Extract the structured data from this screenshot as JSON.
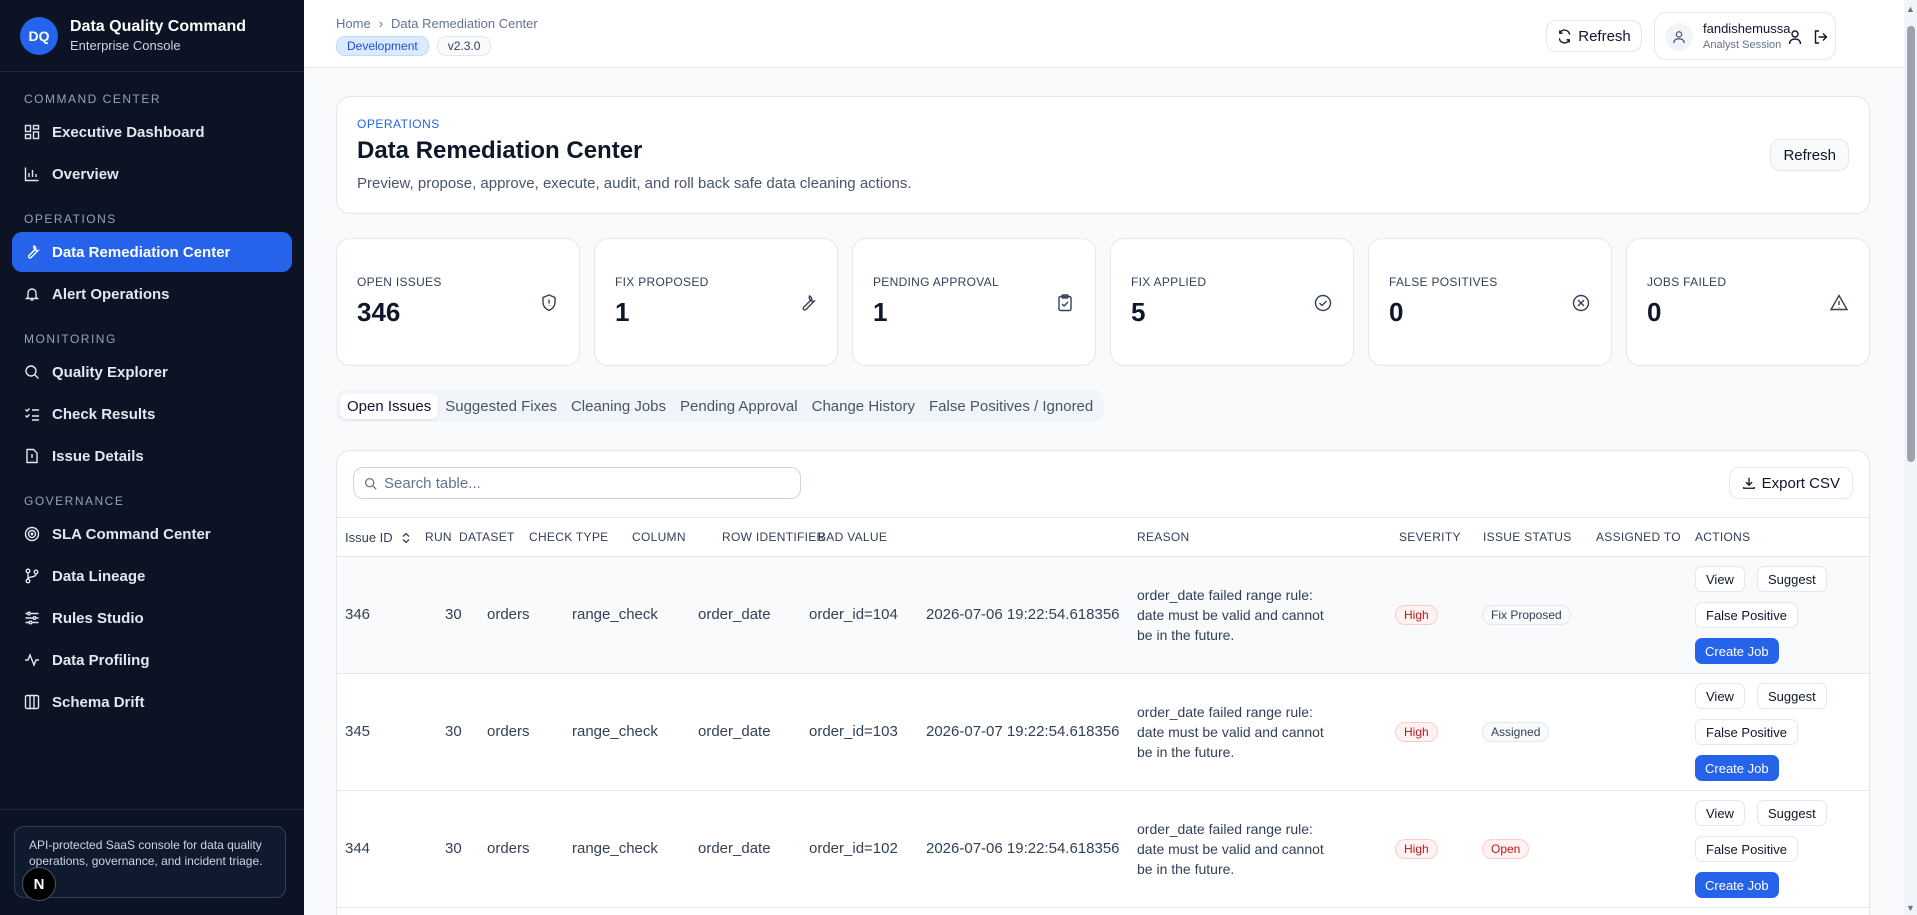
{
  "brand": {
    "logo": "DQ",
    "title": "Data Quality Command",
    "subtitle": "Enterprise Console"
  },
  "sidebar": {
    "sections": [
      {
        "label": "COMMAND CENTER"
      },
      {
        "label": "OPERATIONS"
      },
      {
        "label": "MONITORING"
      },
      {
        "label": "GOVERNANCE"
      }
    ],
    "items": [
      {
        "label": "Executive Dashboard",
        "icon": "dashboard-icon"
      },
      {
        "label": "Overview",
        "icon": "bar-chart-icon"
      },
      {
        "label": "Data Remediation Center",
        "icon": "wrench-icon",
        "active": true
      },
      {
        "label": "Alert Operations",
        "icon": "bell-icon"
      },
      {
        "label": "Quality Explorer",
        "icon": "search-zoom-icon"
      },
      {
        "label": "Check Results",
        "icon": "list-checks-icon"
      },
      {
        "label": "Issue Details",
        "icon": "file-alert-icon"
      },
      {
        "label": "SLA Command Center",
        "icon": "target-icon"
      },
      {
        "label": "Data Lineage",
        "icon": "git-branch-icon"
      },
      {
        "label": "Rules Studio",
        "icon": "sliders-icon"
      },
      {
        "label": "Data Profiling",
        "icon": "activity-icon"
      },
      {
        "label": "Schema Drift",
        "icon": "columns-icon"
      }
    ],
    "footer_text": "API-protected SaaS console for data quality operations, governance, and incident triage.",
    "footer_avatar": "N"
  },
  "topbar": {
    "breadcrumb": [
      "Home",
      "Data Remediation Center"
    ],
    "env_badge": "Development",
    "version_badge": "v2.3.0",
    "refresh_label": "Refresh",
    "user_name": "fandishemussa",
    "user_role": "Analyst Session"
  },
  "header": {
    "kicker": "OPERATIONS",
    "title": "Data Remediation Center",
    "description": "Preview, propose, approve, execute, audit, and roll back safe data cleaning actions.",
    "refresh_label": "Refresh"
  },
  "kpis": [
    {
      "label": "OPEN ISSUES",
      "value": "346",
      "icon": "shield-alert-icon"
    },
    {
      "label": "FIX PROPOSED",
      "value": "1",
      "icon": "wrench-icon"
    },
    {
      "label": "PENDING APPROVAL",
      "value": "1",
      "icon": "clipboard-check-icon"
    },
    {
      "label": "FIX APPLIED",
      "value": "5",
      "icon": "check-circle-icon"
    },
    {
      "label": "FALSE POSITIVES",
      "value": "0",
      "icon": "x-circle-icon"
    },
    {
      "label": "JOBS FAILED",
      "value": "0",
      "icon": "warning-triangle-icon"
    }
  ],
  "tabs": [
    {
      "label": "Open Issues",
      "active": true
    },
    {
      "label": "Suggested Fixes"
    },
    {
      "label": "Cleaning Jobs"
    },
    {
      "label": "Pending Approval"
    },
    {
      "label": "Change History"
    },
    {
      "label": "False Positives / Ignored"
    }
  ],
  "table": {
    "search_placeholder": "Search table...",
    "export_label": "Export CSV",
    "columns": [
      "Issue ID",
      "RUN",
      "DATASET",
      "CHECK TYPE",
      "COLUMN",
      "ROW IDENTIFIER",
      "BAD VALUE",
      "REASON",
      "SEVERITY",
      "ISSUE STATUS",
      "ASSIGNED TO",
      "ACTIONS"
    ],
    "action_labels": {
      "view": "View",
      "suggest": "Suggest",
      "false_positive": "False Positive",
      "create_job": "Create Job"
    },
    "rows": [
      {
        "id": "346",
        "run": "30",
        "dataset": "orders",
        "check_type": "range_check",
        "column": "order_date",
        "row_identifier": "order_id=104",
        "bad_value": "2026-07-06 19:22:54.618356",
        "reason": "order_date failed range rule: date must be valid and cannot be in the future.",
        "severity": "High",
        "status": "Fix Proposed",
        "assigned_to": ""
      },
      {
        "id": "345",
        "run": "30",
        "dataset": "orders",
        "check_type": "range_check",
        "column": "order_date",
        "row_identifier": "order_id=103",
        "bad_value": "2026-07-07 19:22:54.618356",
        "reason": "order_date failed range rule: date must be valid and cannot be in the future.",
        "severity": "High",
        "status": "Assigned",
        "assigned_to": ""
      },
      {
        "id": "344",
        "run": "30",
        "dataset": "orders",
        "check_type": "range_check",
        "column": "order_date",
        "row_identifier": "order_id=102",
        "bad_value": "2026-07-06 19:22:54.618356",
        "reason": "order_date failed range rule: date must be valid and cannot be in the future.",
        "severity": "High",
        "status": "Open",
        "assigned_to": ""
      }
    ]
  },
  "colors": {
    "accent": "#2563eb",
    "sidebar_bg": "#0b1324",
    "danger": "#b91c1c"
  }
}
